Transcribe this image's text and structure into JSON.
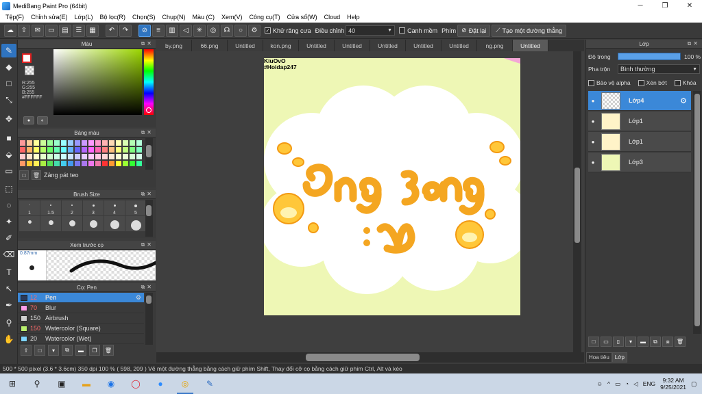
{
  "window": {
    "title": "MediBang Paint Pro (64bit)",
    "minimize": "─",
    "maximize": "❐",
    "close": "✕"
  },
  "menu": [
    "Tệp(F)",
    "Chỉnh sửa(E)",
    "Lớp(L)",
    "Bộ lọc(R)",
    "Chọn(S)",
    "Chụp(N)",
    "Màu (C)",
    "Xem(V)",
    "Công cụ(T)",
    "Cửa sổ(W)",
    "Cloud",
    "Help"
  ],
  "toolbar": {
    "antialias_label": "Khử răng cưa",
    "adjust_label": "Điều chỉnh",
    "adjust_value": "40",
    "snap_label": "Canh mềm",
    "key_label": "Phím",
    "reset_label": "Đặt lại",
    "straight_label": "Tạo một đường thẳng"
  },
  "panels": {
    "color": {
      "title": "Màu",
      "r": "R:255",
      "g": "G:255",
      "b": "B:255",
      "hex": "#FFFFFF",
      "fg_color": "#ffffff",
      "accent": "#e02020"
    },
    "palette": {
      "title": "Bảng màu",
      "label": "Zảng pát teo",
      "colors": [
        "#ff9999",
        "#ffcc99",
        "#ffff99",
        "#ccff99",
        "#99ff99",
        "#99ffcc",
        "#99ffff",
        "#99ccff",
        "#9999ff",
        "#cc99ff",
        "#ff99ff",
        "#ff99cc",
        "#ffb3b3",
        "#ffd9b3",
        "#ffffb3",
        "#d9ffb3",
        "#b3ffb3",
        "#b3ffd9",
        "#ff6666",
        "#ffb366",
        "#ffff66",
        "#b3ff66",
        "#66ff66",
        "#66ffb3",
        "#66ffff",
        "#66b3ff",
        "#6666ff",
        "#b366ff",
        "#ff66ff",
        "#ff66b3",
        "#ff8080",
        "#ffc080",
        "#ffff80",
        "#c0ff80",
        "#80ff80",
        "#80ffc0",
        "#ffcccc",
        "#ffe5cc",
        "#ffffcc",
        "#e5ffcc",
        "#ccffcc",
        "#ccffe5",
        "#ccffff",
        "#cce5ff",
        "#ccccff",
        "#e5ccff",
        "#ffccff",
        "#ffcce5",
        "#ffd6d6",
        "#ffead6",
        "#ffffd6",
        "#eaffd6",
        "#d6ffd6",
        "#d6ffea",
        "#ff9966",
        "#ffcc33",
        "#ffee55",
        "#aaee44",
        "#55dd55",
        "#44ddaa",
        "#44ccee",
        "#4499ee",
        "#7777ee",
        "#aa77ee",
        "#ee77ee",
        "#ee77aa",
        "#ff3333",
        "#ff9933",
        "#ffff33",
        "#99ff33",
        "#33ff33",
        "#33ff99"
      ]
    },
    "brush_size": {
      "title": "Brush Size",
      "sizes": [
        "1",
        "1.5",
        "2",
        "3",
        "4",
        "5"
      ]
    },
    "preview": {
      "title": "Xem trước cọ",
      "size": "0.87mm"
    },
    "brush": {
      "title": "Cọ: Pen",
      "items": [
        {
          "size": "12",
          "name": "Pen",
          "color": "#2a3a5a"
        },
        {
          "size": "70",
          "name": "Blur",
          "color": "#ff9ee8"
        },
        {
          "size": "150",
          "name": "Airbrush",
          "color": "#cfcfcf"
        },
        {
          "size": "150",
          "name": "Watercolor (Square)",
          "color": "#b9ef6e"
        },
        {
          "size": "20",
          "name": "Watercolor (Wet)",
          "color": "#7fd6ff"
        }
      ]
    }
  },
  "tabs": [
    "by.png",
    "66.png",
    "Untitled",
    "kon.png",
    "Untitled",
    "Untitled",
    "Untitled",
    "Untitled",
    "Untitled",
    "ng.png",
    "Untitled"
  ],
  "canvas": {
    "watermark_line1": "KiuOvO",
    "watermark_line2": "#Hoidap247",
    "bg_color": "#eef7b5"
  },
  "layers": {
    "title": "Lớp",
    "opacity_label": "Độ trong",
    "opacity_value": "100 %",
    "blend_label": "Pha trộn",
    "blend_value": "Bình thường",
    "protect_alpha": "Bảo vệ alpha",
    "clip": "Xén bớt",
    "lock": "Khóa",
    "items": [
      "Lớp4",
      "Lớp1",
      "Lớp1",
      "Lớp3"
    ],
    "tab_paint": "Hoa tiêu",
    "tab_layer": "Lớp"
  },
  "status": {
    "text": "500 * 500 pixel   (3.6 * 3.6cm)   350 dpi   100 %   ( 598, 209 )   Vẽ một đường thẳng bằng cách giữ phím Shift, Thay đổi cỡ cọ bằng cách giữ phím Ctrl, Alt và kéo"
  },
  "taskbar": {
    "time": "9:32 AM",
    "date": "9/25/2021",
    "lang": "ENG"
  }
}
